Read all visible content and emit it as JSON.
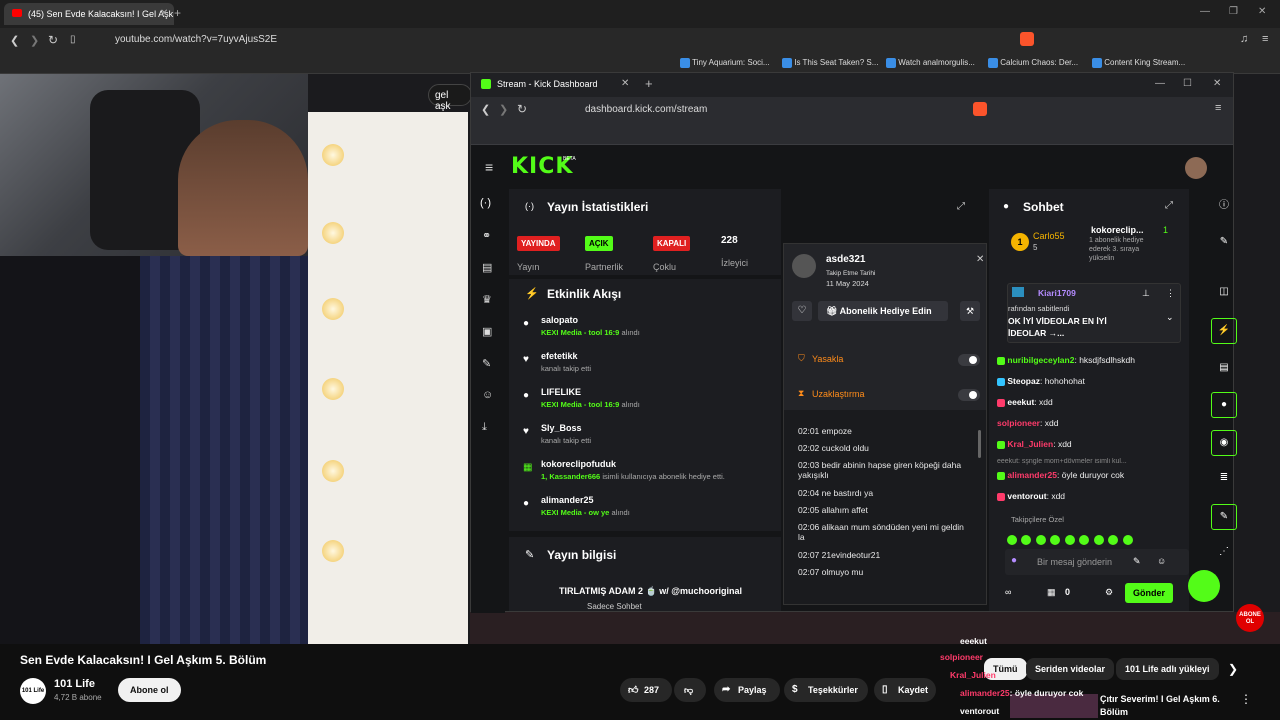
{
  "outer_browser": {
    "tab_title": "(45) Sen Evde Kalacaksın! I Gel Aşkım",
    "url": "youtube.com/watch?v=7uyvAjusS2E",
    "bookmarks": [
      "Tiny Aquarium: Soci...",
      "Is This Seat Taken? S...",
      "Watch analmorgulis...",
      "Calcium Chaos: Der...",
      "Content King Stream..."
    ],
    "search_chip": "gel aşk"
  },
  "kick_window": {
    "tab_title": "Stream - Kick Dashboard",
    "url": "dashboard.kick.com/stream",
    "logo": "KICK",
    "logo_sup": "BETA",
    "stats": {
      "title": "Yayın İstatistikleri",
      "items": [
        {
          "badge": "YAYINDA",
          "label": "Yayın",
          "color": "#e02020"
        },
        {
          "badge": "AÇIK",
          "label": "Partnerlik",
          "color": "#53fc18"
        },
        {
          "badge": "KAPALI",
          "label": "Çoklu",
          "color": "#e02020"
        },
        {
          "badge": "228",
          "label": "İzleyici",
          "color": "none"
        }
      ]
    },
    "activity": {
      "title": "Etkinlik Akışı",
      "items": [
        {
          "icon": "gift-icon",
          "name": "salopato",
          "detail_hl": "KEXI Media - tool 16:9",
          "detail": "alındı"
        },
        {
          "icon": "heart-icon",
          "name": "efetetikk",
          "detail_hl": "",
          "detail": "kanalı takip etti"
        },
        {
          "icon": "gift-icon",
          "name": "LIFELIKE",
          "detail_hl": "KEXI Media - tool 16:9",
          "detail": "alındı"
        },
        {
          "icon": "heart-icon",
          "name": "Sly_Boss",
          "detail_hl": "",
          "detail": "kanalı takip etti"
        },
        {
          "icon": "sub-icon",
          "name": "kokoreclipofuduk",
          "detail_hl": "1, Kassander666",
          "detail": "isimli kullanıcıya abonelik hediye etti."
        },
        {
          "icon": "gift-icon",
          "name": "alimander25",
          "detail_hl": "KEXI Media - ow ye",
          "detail": "alındı"
        }
      ]
    },
    "stream_info": {
      "title": "Yayın bilgisi",
      "stream_title": "TIRLATMIŞ ADAM 2 🍵 w/ @muchooriginal",
      "category": "Sadece Sohbet"
    },
    "user_card": {
      "username": "asde321",
      "follow_label": "Takip Etme Tarihi",
      "follow_date": "11 May 2024",
      "gift_label": "Abonelik Hediye Edin",
      "ban_label": "Yasakla",
      "timeout_label": "Uzaklaştırma",
      "log": [
        {
          "t": "02:01",
          "m": "empoze"
        },
        {
          "t": "02:02",
          "m": "cuckold oldu"
        },
        {
          "t": "02:03",
          "m": "bedir abinin hapse giren köpeği daha yakışıklı"
        },
        {
          "t": "02:04",
          "m": "ne bastırdı ya"
        },
        {
          "t": "02:05",
          "m": "allahım affet"
        },
        {
          "t": "02:06",
          "m": "alikaan mum söndüden yeni mi geldin la"
        },
        {
          "t": "02:07",
          "m": "21evindeotur21"
        },
        {
          "t": "02:07",
          "m": "olmuyo mu"
        }
      ]
    },
    "chat": {
      "title": "Sohbet",
      "top_gifter": {
        "name": "Carlo55",
        "count": "5"
      },
      "gift_user": "kokoreclip...",
      "gift_count": "1",
      "gift_text1": "1 abonelik hediye",
      "gift_text2": "ederek 3. sıraya",
      "gift_text3": "yükselin",
      "pinned_user": "Kiari1709",
      "pinned_by": "rafından sabitlendi",
      "pinned_msg1": "OK İYİ VİDEOLAR EN İYİ",
      "pinned_msg2": "İDEOLAR →...",
      "messages": [
        {
          "user": "nuribilgeceylan2",
          "color": "#53fc18",
          "msg": "hksdjfsdlhskdh"
        },
        {
          "user": "Steopaz",
          "color": "#33c4ff",
          "msg": "hohohohat"
        },
        {
          "user": "eeekut",
          "color": "#ffffff",
          "msg": "xdd"
        },
        {
          "user": "solpioneer",
          "color": "#ff3b6b",
          "msg": "xdd"
        },
        {
          "user": "Kral_Julien",
          "color": "#ff3b6b",
          "msg": "xdd"
        },
        {
          "user": "alimander25",
          "color": "#ff3b6b",
          "msg": "öyle duruyor cok"
        },
        {
          "user": "ventorout",
          "color": "#ffffff",
          "msg": "xdd"
        }
      ],
      "reply_hint": "eeekut: sşngle mom+dövmeler isimli kul...",
      "followers_only": "Takipçilere Özel",
      "input_placeholder": "Bir mesaj gönderin",
      "send_label": "Gönder",
      "points": "0"
    }
  },
  "youtube": {
    "video_title": "Sen Evde Kalacaksın! I Gel Aşkım 5. Bölüm",
    "channel_name": "101 Life",
    "channel_logo": "101 Life",
    "subscribers": "4,72 B abone",
    "subscribe_label": "Abone ol",
    "likes": "287",
    "share_label": "Paylaş",
    "thanks_label": "Teşekkürler",
    "save_label": "Kaydet",
    "chips": [
      "Tümü",
      "Seriden videolar",
      "101 Life adlı yükleyi"
    ],
    "next_video": {
      "title1": "Çıtır Severim! I Gel Aşkım 6.",
      "title2": "Bölüm"
    },
    "overlay_chat": [
      "eeekut",
      "solpioneer",
      "Kral_Julien",
      "alimander25",
      "ventorout"
    ],
    "overlay_msg": ": öyle duruyor cok",
    "abone_badge1": "ABONE",
    "abone_badge2": "OL"
  }
}
